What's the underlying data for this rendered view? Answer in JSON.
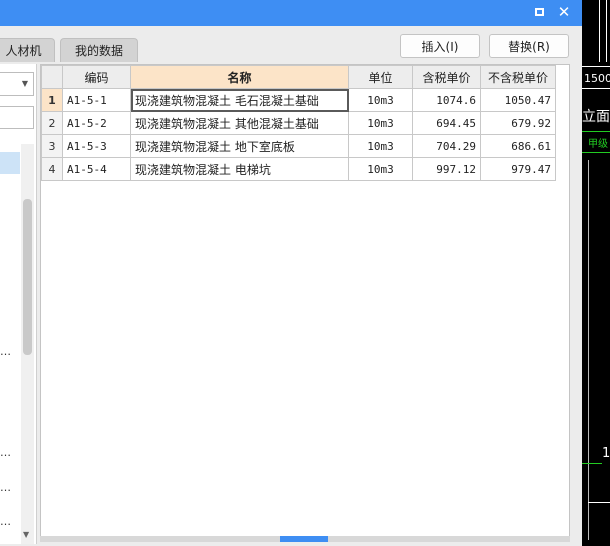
{
  "window": {
    "maximize_icon": "maximize-icon",
    "close_glyph": "✕"
  },
  "tabs": [
    {
      "label": "人材机"
    },
    {
      "label": "我的数据"
    }
  ],
  "actions": {
    "insert_label": "插入(I)",
    "replace_label": "替换(R)"
  },
  "left_panel": {
    "ellipsis_1": "…",
    "ellipsis_2": "…",
    "ellipsis_3": "…",
    "ellipsis_4": "…",
    "dropdown_icon": "chevron-down-icon"
  },
  "table": {
    "columns": [
      "",
      "编码",
      "名称",
      "单位",
      "含税单价",
      "不含税单价"
    ],
    "rows": [
      {
        "n": "1",
        "code": "A1-5-1",
        "name": "现浇建筑物混凝土 毛石混凝土基础",
        "unit": "10m3",
        "price_tax": "1074.6",
        "price_notax": "1050.47"
      },
      {
        "n": "2",
        "code": "A1-5-2",
        "name": "现浇建筑物混凝土 其他混凝土基础",
        "unit": "10m3",
        "price_tax": "694.45",
        "price_notax": "679.92"
      },
      {
        "n": "3",
        "code": "A1-5-3",
        "name": "现浇建筑物混凝土 地下室底板",
        "unit": "10m3",
        "price_tax": "704.29",
        "price_notax": "686.61"
      },
      {
        "n": "4",
        "code": "A1-5-4",
        "name": "现浇建筑物混凝土 电梯坑",
        "unit": "10m3",
        "price_tax": "997.12",
        "price_notax": "979.47"
      }
    ]
  },
  "background_cad": {
    "text_1": "1500",
    "text_2": "立面",
    "text_3": "甲级",
    "text_4": "1"
  },
  "colors": {
    "titlebar": "#3e8ef3",
    "header_highlight": "#fce4c8",
    "cad_green": "#22cc22"
  }
}
